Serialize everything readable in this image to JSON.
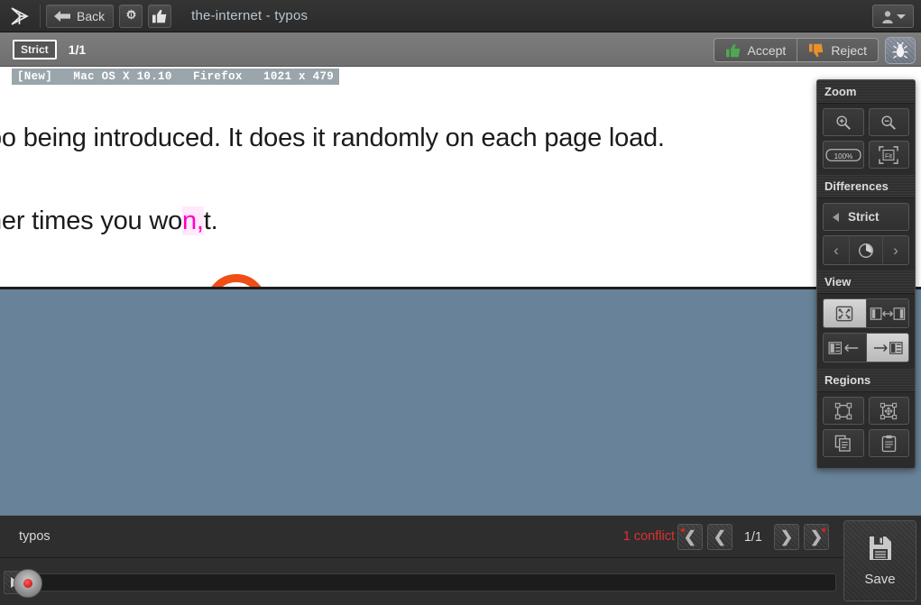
{
  "titlebar": {
    "logo_icon": "applitools-eyes-logo",
    "back_label": "Back",
    "settings_icon": "gear-icon",
    "thumbsup_icon": "thumbs-up-icon",
    "title": "the-internet - typos",
    "user_icon": "user-avatar-icon",
    "user_caret_icon": "chevron-down-icon"
  },
  "subbar": {
    "strict_label": "Strict",
    "page_count": "1/1",
    "accept_label": "Accept",
    "accept_icon": "thumbs-up-icon",
    "reject_label": "Reject",
    "reject_icon": "thumbs-down-icon",
    "bug_icon": "bug-icon",
    "accept_color": "#4fa84f",
    "reject_color": "#e8912c"
  },
  "info_strip": {
    "status": "[New]",
    "os": "Mac OS X 10.10",
    "browser": "Firefox",
    "viewport": "1021 x 479",
    "full_text": "[New]   Mac OS X 10.10   Firefox   1021 x 479"
  },
  "content": {
    "line1": "po being introduced. It does it randomly on each page load.",
    "line2_before": "her times you wo",
    "line2_diff": "n,",
    "line2_after": "t.",
    "diff_highlight_color": "#ff00c8",
    "diff_circle_color": "#f04e17",
    "background_color": "#688399"
  },
  "toolpanel": {
    "zoom": {
      "title": "Zoom",
      "buttons": [
        {
          "name": "zoom-in-icon",
          "label": ""
        },
        {
          "name": "zoom-out-icon",
          "label": ""
        },
        {
          "name": "zoom-100-icon",
          "label": "100%"
        },
        {
          "name": "zoom-fit-icon",
          "label": "Fit"
        }
      ]
    },
    "differences": {
      "title": "Differences",
      "mode_label": "Strict",
      "mode_caret_icon": "triangle-left-icon",
      "prev_icon": "chevron-left-icon",
      "refresh_icon": "refresh-icon",
      "next_icon": "chevron-right-icon"
    },
    "view": {
      "title": "View",
      "buttons": [
        {
          "name": "view-overlay-icon",
          "active": true
        },
        {
          "name": "view-side-by-side-icon",
          "active": false
        },
        {
          "name": "view-baseline-icon",
          "active": false
        },
        {
          "name": "view-checkpoint-icon",
          "active": true
        }
      ]
    },
    "regions": {
      "title": "Regions",
      "buttons": [
        {
          "name": "region-ignore-icon"
        },
        {
          "name": "region-floating-icon"
        },
        {
          "name": "region-copy-icon"
        },
        {
          "name": "region-paste-icon"
        }
      ]
    }
  },
  "bottombar": {
    "test_name": "typos",
    "conflict_text": "1 conflict",
    "conflict_color": "#e03030",
    "step_count": "1/1",
    "nav": {
      "first_icon": "nav-first-icon",
      "prev_icon": "nav-prev-icon",
      "next_icon": "nav-next-icon",
      "last_icon": "nav-last-icon"
    },
    "play_icon": "play-icon",
    "scrubber_handle_icon": "scrubber-handle-icon",
    "save_label": "Save",
    "save_icon": "floppy-disk-icon"
  }
}
